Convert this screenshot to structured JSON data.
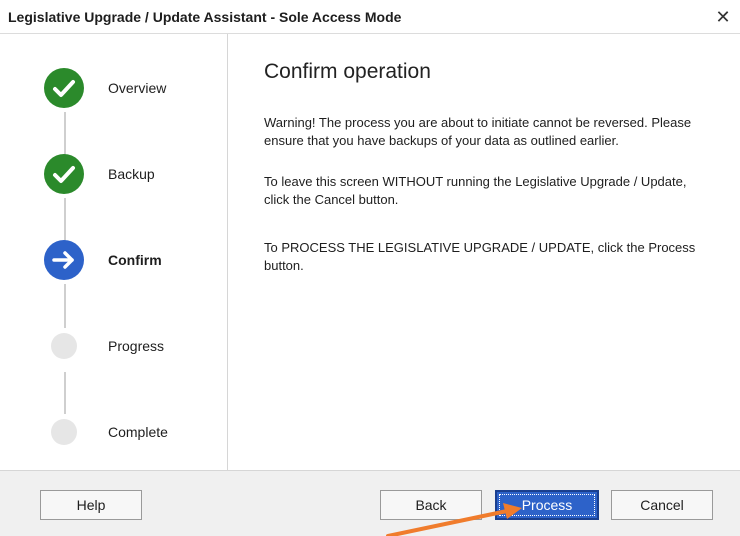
{
  "window": {
    "title": "Legislative Upgrade / Update Assistant - Sole Access Mode",
    "close_glyph": "✕"
  },
  "steps": [
    {
      "label": "Overview",
      "state": "done"
    },
    {
      "label": "Backup",
      "state": "done"
    },
    {
      "label": "Confirm",
      "state": "current"
    },
    {
      "label": "Progress",
      "state": "pending"
    },
    {
      "label": "Complete",
      "state": "pending"
    }
  ],
  "content": {
    "heading": "Confirm operation",
    "paragraphs": [
      "Warning! The process you are about to initiate cannot be reversed. Please ensure that you have backups of your data as outlined earlier.",
      "To leave this screen WITHOUT running the Legislative Upgrade / Update, click the Cancel button.",
      "To  PROCESS THE LEGISLATIVE UPGRADE / UPDATE, click the Process button."
    ]
  },
  "footer": {
    "help_label": "Help",
    "back_label": "Back",
    "process_label": "Process",
    "cancel_label": "Cancel"
  },
  "colors": {
    "done": "#2b8a2b",
    "current": "#2d62c9",
    "pending": "#e6e6e6",
    "annotation_arrow": "#f07c2c"
  }
}
